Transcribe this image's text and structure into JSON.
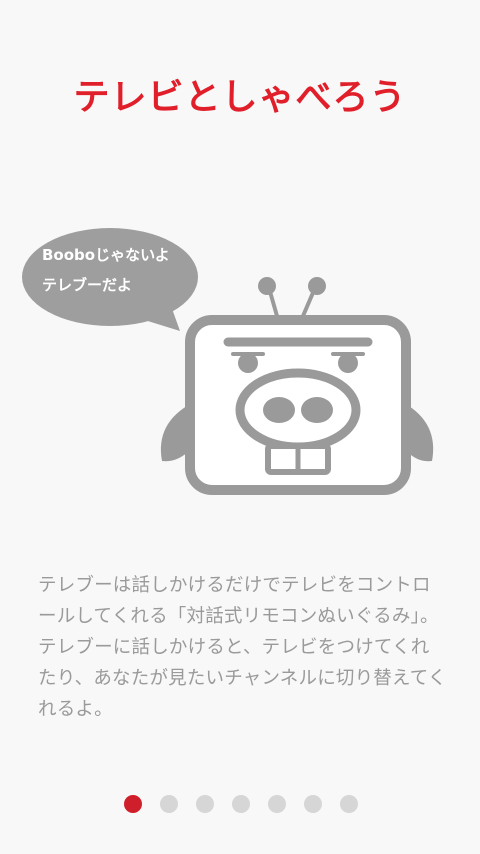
{
  "title": "テレビとしゃべろう",
  "speech_bubble": {
    "line1": "Booboじゃないよ",
    "line2": "テレブーだよ"
  },
  "description": "テレブーは話しかけるだけでテレビをコントロールしてくれる「対話式リモコンぬいぐるみ」。テレブーに話しかけると、テレビをつけてくれたり、あなたが見たいチャンネルに切り替えてくれるよ。",
  "pager": {
    "active_index": 0,
    "total": 7
  },
  "colors": {
    "title": "#e01f2a",
    "character": "#9a9a9a",
    "active_dot": "#cf1f2b",
    "inactive_dot": "#d6d6d6"
  },
  "icons": [
    "telebu-character-icon",
    "speech-bubble"
  ]
}
